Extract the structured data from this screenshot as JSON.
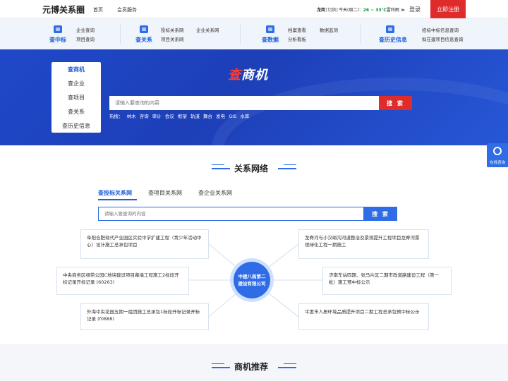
{
  "topbar": {
    "brand": "元博关系圈",
    "nav": [
      "首页",
      "会员服务"
    ],
    "city": "龙岗",
    "city_switch": "[切换]",
    "weather_prefix": "今天(周二)：",
    "weather_temp": "26 ~ 33℃",
    "weather_desc": "雷阵雨 ≫",
    "login": "登录",
    "register": "立即注册"
  },
  "categories": [
    {
      "title": "查中标",
      "links": [
        "企业查询",
        "项目查询"
      ]
    },
    {
      "title": "查关系",
      "links": [
        "投标关系网",
        "企业关系网",
        "项目关系网"
      ]
    },
    {
      "title": "查数据",
      "links": [
        "档案查看",
        "数据监测",
        "分析看板"
      ]
    },
    {
      "title": "查历史信息",
      "links": [
        "招标中标信息查询",
        "拟在建项目信息查询"
      ]
    }
  ],
  "hero": {
    "logo_red": "查",
    "logo_white": "商机",
    "side_menu": [
      "查商机",
      "查企业",
      "查项目",
      "查关系",
      "查历史信息"
    ],
    "search_placeholder": "请输入要查询的内容",
    "search_button": "搜 索",
    "hot_label": "热搜：",
    "hot_words": [
      "林木",
      "咨询",
      "审计",
      "会议",
      "框架",
      "轨道",
      "舞台",
      "发电",
      "GIS",
      "水库"
    ]
  },
  "float_service": {
    "label": "在线咨询",
    "icon": "headset-icon"
  },
  "network_section": {
    "title": "关系网络",
    "tabs": [
      "查投标关系网",
      "查项目关系网",
      "查企业关系网"
    ],
    "search_placeholder": "请输入要查询的内容",
    "search_button": "搜 索",
    "center": "中建八局第二建设有限公司",
    "left_nodes": [
      "阜阳合肥现代产业园区实验中学扩建工程（青少年活动中心）设计施工总承包项目",
      "中央商务区绸带公园C地块建设项目幕墙工程施工2标段开标记录开标记录 (60263)",
      "外海中央花园五期一组团施工总承包1标段开标记录开标记录 (f0888)"
    ],
    "right_nodes": [
      "龙脊河与小汉峪沟河道整治及景观提升工程项目龙脊河景观绿化工程一期施工",
      "济南东站四期、张马片区二期市政道路建设工程（第一批）施工预中标公示",
      "平度市人居环境品质提升项目二期工程总承包预中标公示"
    ]
  },
  "recommend_section": {
    "title": "商机推荐"
  },
  "colors": {
    "accent": "#2f6ce5",
    "brand_red": "#e02b2b",
    "hero_blue": "#1f49c9"
  }
}
